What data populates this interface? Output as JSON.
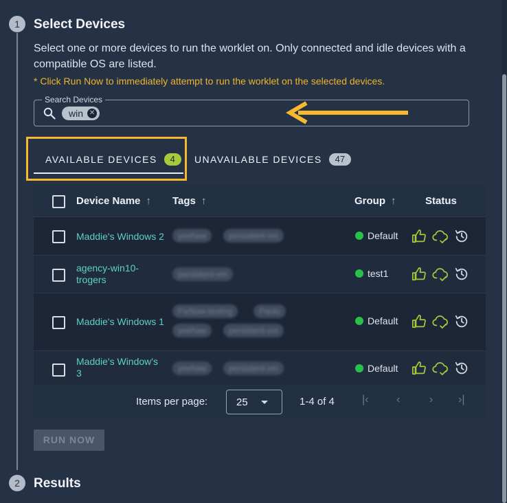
{
  "steps": [
    {
      "number": "1",
      "title": "Select Devices"
    },
    {
      "number": "2",
      "title": "Results"
    }
  ],
  "description": "Select one or more devices to run the worklet on. Only connected and idle devices with a compatible OS are listed.",
  "note": "* Click Run Now to immediately attempt to run the worklet on the selected devices.",
  "search": {
    "label": "Search Devices",
    "chip": "win",
    "chip_remove": "✕"
  },
  "tabs": [
    {
      "label": "AVAILABLE DEVICES",
      "count": "4",
      "badge_color": "#a8c93a"
    },
    {
      "label": "UNAVAILABLE DEVICES",
      "count": "47",
      "badge_color": "#b9c1cc"
    }
  ],
  "table": {
    "headers": {
      "name": "Device Name",
      "tags": "Tags",
      "group": "Group",
      "status": "Status",
      "sort": "↑"
    },
    "rows": [
      {
        "name": "Maddie's Windows 2",
        "tags": [
          "yeehaw",
          "persistent-vm"
        ],
        "group": "Default"
      },
      {
        "name": "agency-win10-trogers",
        "tags": [
          "persistent-vm"
        ],
        "group": "test1"
      },
      {
        "name": "Maddie's Windows 1",
        "tags": [
          "FixNow-testing",
          "Paolo",
          "yeehaw",
          "persistent-vm"
        ],
        "group": "Default"
      },
      {
        "name": "Maddie's Window's 3",
        "tags": [
          "yeehaw",
          "persistent-vm"
        ],
        "group": "Default"
      }
    ],
    "status_icons": [
      "thumbs-up-icon",
      "cloud-check-icon",
      "history-icon"
    ]
  },
  "pagination": {
    "items_label": "Items per page:",
    "page_size": "25",
    "range": "1-4 of 4",
    "first": "|‹",
    "prev": "‹",
    "next": "›",
    "last": "›|"
  },
  "run_button": "RUN NOW",
  "colors": {
    "accent": "#f5b82e",
    "link": "#5fd0c7",
    "status_green": "#a8c93a",
    "online": "#2bc04a"
  }
}
